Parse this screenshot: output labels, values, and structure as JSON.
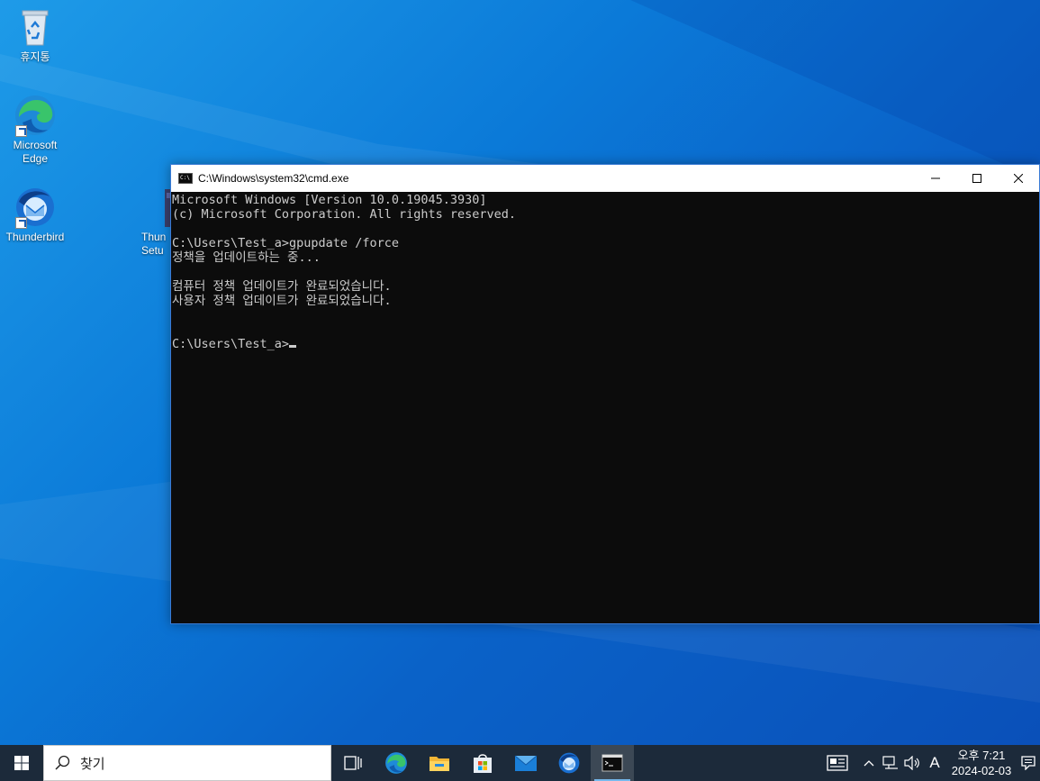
{
  "desktop": {
    "icons": [
      {
        "label": "휴지통",
        "icon": "recycle-bin-icon"
      },
      {
        "label": "Microsoft\nEdge",
        "icon": "edge-icon"
      },
      {
        "label": "Thunderbird",
        "icon": "thunderbird-icon"
      },
      {
        "label": "Thun\nSetu",
        "icon": "installer-icon"
      }
    ]
  },
  "cmd": {
    "title": "C:\\Windows\\system32\\cmd.exe",
    "icon_text": "C:\\",
    "lines": [
      "Microsoft Windows [Version 10.0.19045.3930]",
      "(c) Microsoft Corporation. All rights reserved.",
      "",
      "C:\\Users\\Test_a>gpupdate /force",
      "정책을 업데이트하는 중...",
      "",
      "컴퓨터 정책 업데이트가 완료되었습니다.",
      "사용자 정책 업데이트가 완료되었습니다.",
      "",
      ""
    ],
    "prompt": "C:\\Users\\Test_a>",
    "controls": {
      "minimize": "─",
      "maximize": "☐",
      "close": "✕"
    }
  },
  "taskbar": {
    "search_label": "찾기",
    "apps": [
      "task-view-icon",
      "edge-icon",
      "file-explorer-icon",
      "store-icon",
      "mail-icon",
      "thunderbird-icon",
      "cmd-icon"
    ],
    "tray": {
      "ime": "A",
      "time": "오후 7:21",
      "date": "2024-02-03"
    }
  },
  "colors": {
    "console_bg": "#0c0c0c",
    "console_fg": "#cccccc",
    "taskbar_bg": "#1c2a3a",
    "desktop_blue": "#0b7ad8"
  }
}
